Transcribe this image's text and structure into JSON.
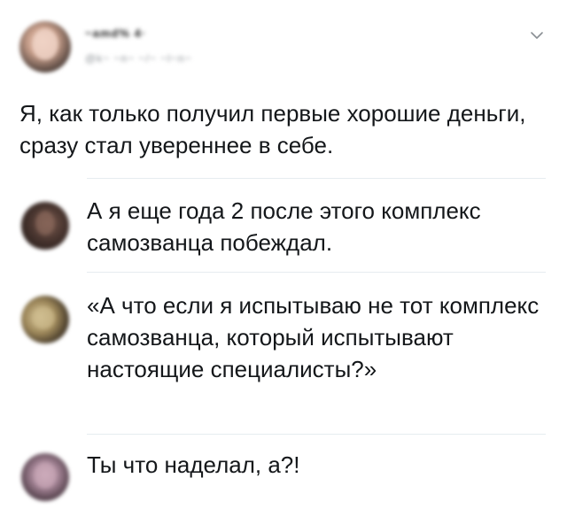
{
  "main_tweet": {
    "display_name": "~amd% 4·",
    "handle": "@k~ ~n~ ~/~ ~l~n~",
    "text": "Я, как только получил первые хорошие деньги, сразу стал увереннее в себе.",
    "menu_icon": "chevron-down-icon"
  },
  "replies": [
    {
      "text": "А я еще года 2 после этого комплекс самозванца побеждал."
    },
    {
      "text": "«А что если я испытываю не тот комплекс самозванца, который испытывают настоящие специалисты?»"
    },
    {
      "text": "Ты что наделал, а?!"
    }
  ],
  "colors": {
    "text": "#14171a",
    "divider": "#e6ecf0",
    "icon": "#8a8f94"
  }
}
